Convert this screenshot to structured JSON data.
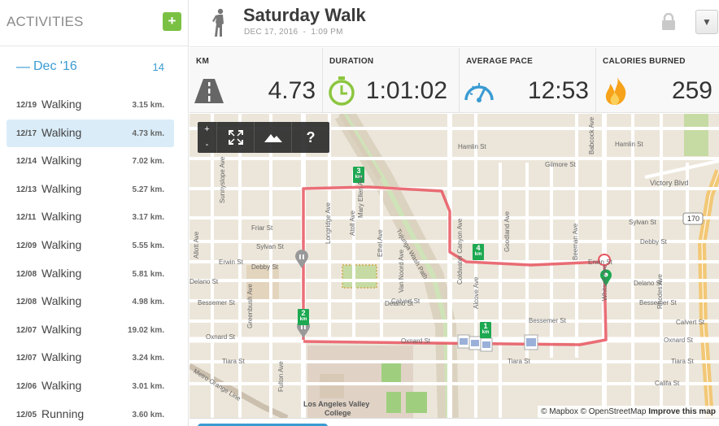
{
  "sidebar": {
    "title": "ACTIVITIES",
    "add_label": "+",
    "month": {
      "dash": "—",
      "label": "Dec '16",
      "count": "14"
    },
    "activities": [
      {
        "date": "12/19",
        "name": "Walking",
        "distance": "3.15 km.",
        "selected": false
      },
      {
        "date": "12/17",
        "name": "Walking",
        "distance": "4.73 km.",
        "selected": true
      },
      {
        "date": "12/14",
        "name": "Walking",
        "distance": "7.02 km.",
        "selected": false
      },
      {
        "date": "12/13",
        "name": "Walking",
        "distance": "5.27 km.",
        "selected": false
      },
      {
        "date": "12/11",
        "name": "Walking",
        "distance": "3.17 km.",
        "selected": false
      },
      {
        "date": "12/09",
        "name": "Walking",
        "distance": "5.55 km.",
        "selected": false
      },
      {
        "date": "12/08",
        "name": "Walking",
        "distance": "5.81 km.",
        "selected": false
      },
      {
        "date": "12/08",
        "name": "Walking",
        "distance": "4.98 km.",
        "selected": false
      },
      {
        "date": "12/07",
        "name": "Walking",
        "distance": "19.02 km.",
        "selected": false
      },
      {
        "date": "12/07",
        "name": "Walking",
        "distance": "3.24 km.",
        "selected": false
      },
      {
        "date": "12/06",
        "name": "Walking",
        "distance": "3.01 km.",
        "selected": false
      },
      {
        "date": "12/05",
        "name": "Running",
        "distance": "3.60 km.",
        "selected": false
      }
    ]
  },
  "header": {
    "title": "Saturday Walk",
    "date": "DEC 17, 2016",
    "separator": "-",
    "time": "1:09 PM",
    "dropdown": "▼"
  },
  "stats": {
    "km": {
      "label": "KM",
      "value": "4.73"
    },
    "duration": {
      "label": "DURATION",
      "value": "1:01:02"
    },
    "pace": {
      "label": "AVERAGE PACE",
      "value": "12:53"
    },
    "calories": {
      "label": "CALORIES BURNED",
      "value": "259"
    }
  },
  "map": {
    "controls": {
      "zoom_in": "+",
      "zoom_out": "-",
      "fullscreen": "⛶",
      "terrain": "▲",
      "help": "?"
    },
    "attribution": {
      "mapbox": "© Mapbox",
      "osm": "© OpenStreetMap",
      "improve": "Improve this map"
    },
    "route_color": "#e8555f",
    "markers": [
      {
        "num": "1",
        "unit": "km"
      },
      {
        "num": "2",
        "unit": "km"
      },
      {
        "num": "3",
        "unit": "km"
      },
      {
        "num": "4",
        "unit": "km"
      }
    ],
    "streets": {
      "hamlin": "Hamlin St",
      "hamlin2": "Hamlin St",
      "gilmore": "Gilmore St",
      "victory": "Victory Blvd",
      "friar": "Friar St",
      "sylvan1": "Sylvan St",
      "sylvan2": "Sylvan St",
      "debby1": "Debby St",
      "debby2": "Debby St",
      "erwin1": "Erwin St",
      "erwin2": "Erwin St",
      "delano1": "Delano St",
      "delano2": "Delano St",
      "delano3": "Delano St",
      "bessemer1": "Bessemer St",
      "bessemer2": "Bessemer St",
      "bessemer3": "Bessemer St",
      "calvert1": "Calvert St",
      "calvert2": "Calvert St",
      "oxnard1": "Oxnard St",
      "oxnard2": "Oxnard St",
      "oxnard3": "Oxnard St",
      "tiara1": "Tiara St",
      "tiara2": "Tiara St",
      "tiara3": "Tiara St",
      "califa": "Califa St",
      "hwy": "170",
      "lavc": "Los Angeles Valley",
      "lavc2": "College",
      "tujunga": "Tujunga Wash Path",
      "metro": "Metro Orange Line",
      "fulton": "Fulton Ave",
      "coldwater": "Coldwater Canyon Ave",
      "whitsett": "Whitsett Ave",
      "ethel": "Ethel Ave",
      "atoll": "Atoll Ave",
      "mary": "Mary Ellen Ave",
      "longridge": "Longridge Ave",
      "vannoord": "Van Noord Ave",
      "greenbush": "Greenbush Ave",
      "babcock": "Babcock Ave",
      "rhodes": "Rhodes Ave",
      "beeman": "Beeman Ave",
      "alcove": "Alcove Ave",
      "goodland": "Goodland Ave",
      "allott": "Allott Ave",
      "sunny": "Sunnyslope Ave"
    }
  }
}
